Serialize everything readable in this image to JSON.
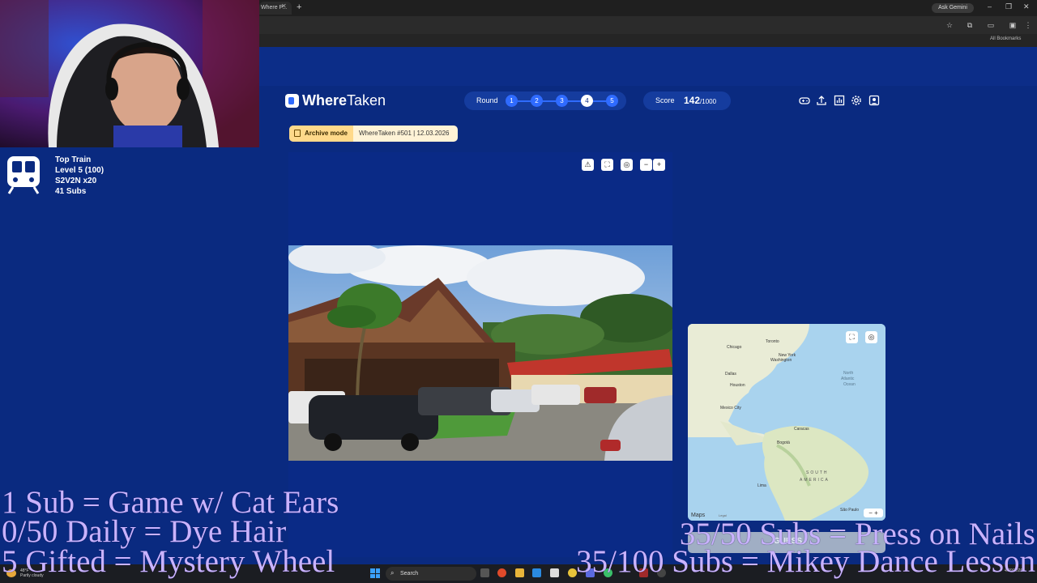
{
  "browser": {
    "tab_title": "Where P...",
    "ask_gemini": "Ask Gemini",
    "all_bookmarks": "All Bookmarks"
  },
  "app": {
    "brand_bold": "Where",
    "brand_rest": "Taken",
    "round_label": "Round",
    "rounds": [
      "1",
      "2",
      "3",
      "4",
      "5"
    ],
    "current_round": "4",
    "score_label": "Score",
    "score_value": "142",
    "score_max": "/1000",
    "archive_label": "Archive mode",
    "archive_info": "WhereTaken #501 | 12.03.2026",
    "guess_button": "GUESS"
  },
  "map": {
    "labels": [
      "Chicago",
      "Toronto",
      "New York",
      "Washington",
      "Dallas",
      "Houston",
      "Mexico City",
      "North",
      "Atlantic",
      "Ocean",
      "Caracas",
      "Bogotá",
      "SOUTH",
      "AMERICA",
      "Lima",
      "São Paulo"
    ],
    "attribution": "Maps",
    "legal": "Legal"
  },
  "stream": {
    "train_title": "Top Train",
    "train_level": "Level 5  (100)",
    "train_user": "S2V2N x20",
    "train_subs": "41 Subs",
    "goal_1": "1 Sub = Game w/ Cat Ears",
    "goal_2": "0/50 Daily = Dye Hair",
    "goal_3": "5 Gifted = Mystery Wheel",
    "goal_4": "35/50 Subs = Press on Nails",
    "goal_5": "35/100 Subs = Mikey Dance Lesson"
  },
  "taskbar": {
    "search": "Search",
    "weather_temp": "48°F",
    "weather_desc": "Partly cloudy",
    "date": "4/29/2026"
  }
}
